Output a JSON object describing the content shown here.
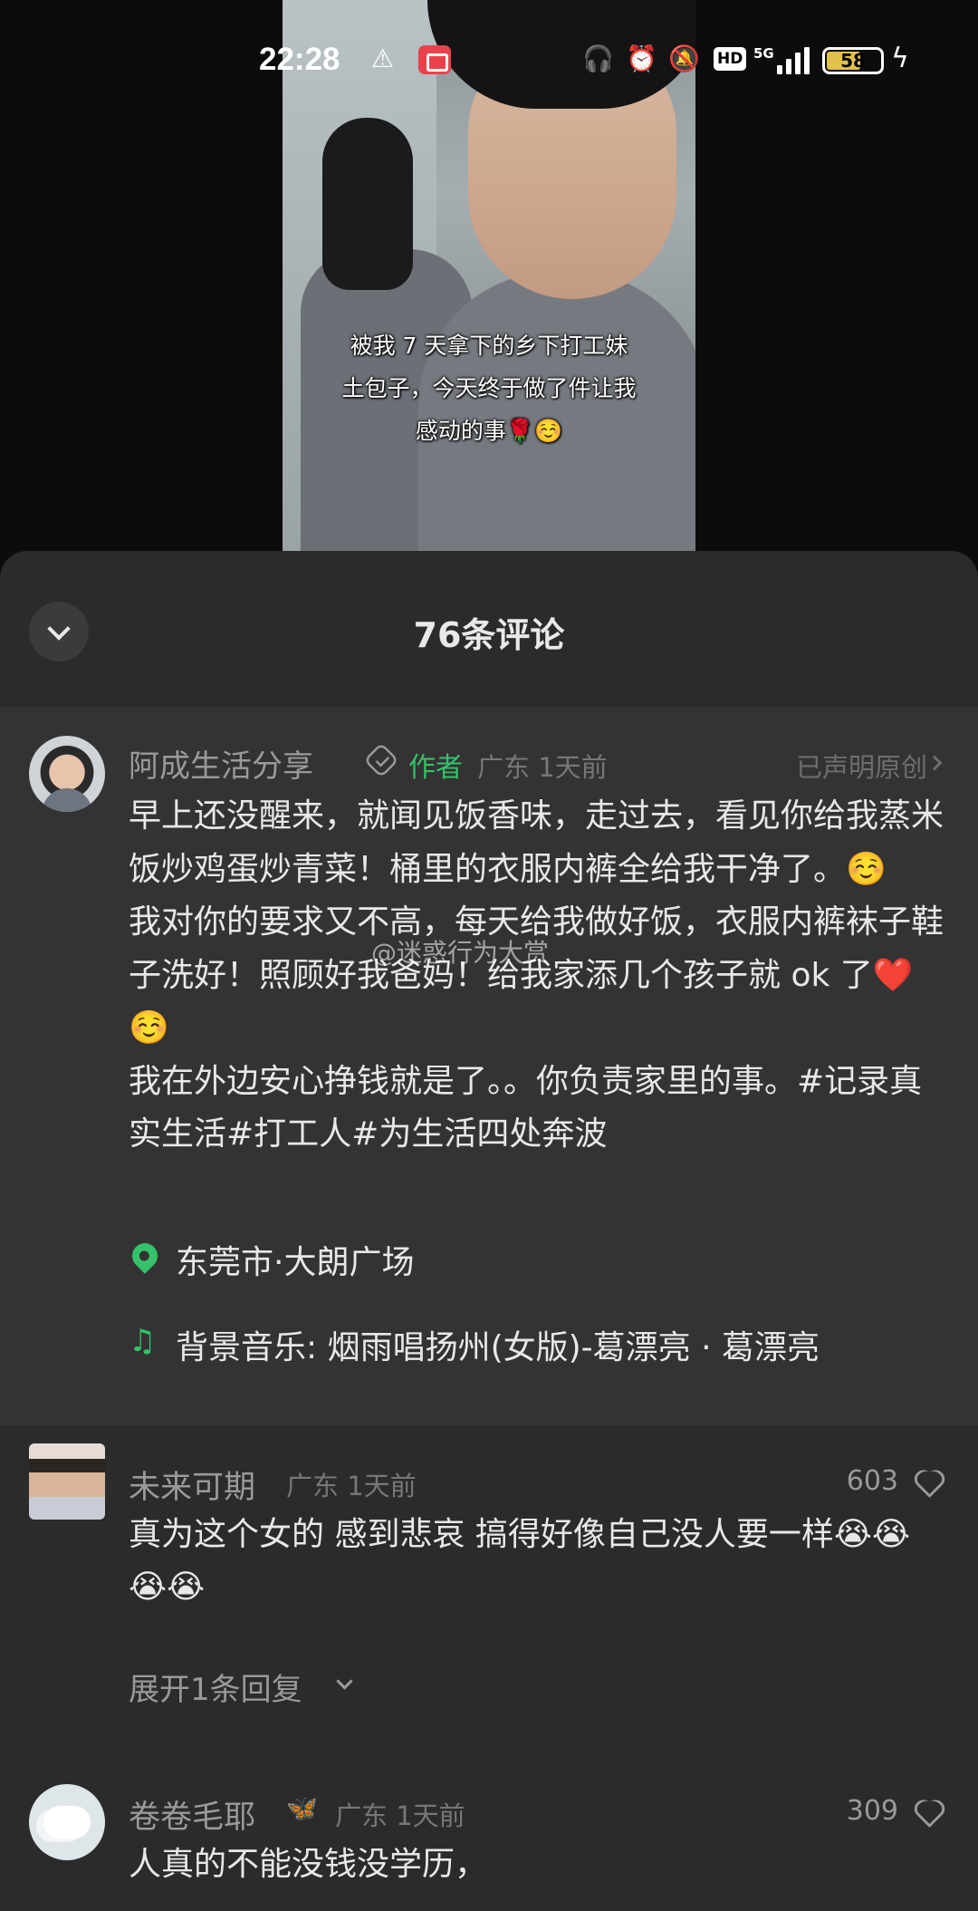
{
  "status_bar": {
    "time": "22:28",
    "network": "5G",
    "hd_label": "HD",
    "battery_level": "58",
    "icons": [
      "warning-icon",
      "screen-record-icon",
      "headphones-icon",
      "alarm-icon",
      "mute-icon",
      "hd-icon",
      "signal-icon",
      "battery-icon",
      "charging-icon"
    ]
  },
  "video": {
    "caption_line1": "被我 7 天拿下的乡下打工妹",
    "caption_line2": "土包子，今天终于做了件让我",
    "caption_line3": "感动的事🌹☺️"
  },
  "sheet": {
    "title": "76条评论"
  },
  "author_post": {
    "name": "阿成生活分享",
    "tag": "作者",
    "meta": "广东 1天前",
    "original_label": "已声明原创",
    "text": "早上还没醒来，就闻见饭香味，走过去，看见你给我蒸米饭炒鸡蛋炒青菜！桶里的衣服内裤全给我干净了。☺️\n我对你的要求又不高，每天给我做好饭，衣服内裤袜子鞋子洗好！照顾好我爸妈！给我家添几个孩子就 ok 了❤️☺️\n我在外边安心挣钱就是了。。你负责家里的事。#记录真实生活#打工人#为生活四处奔波",
    "location": "东莞市·大朗广场",
    "music": "背景音乐: 烟雨唱扬州(女版)-葛漂亮 · 葛漂亮"
  },
  "watermark": "@迷惑行为大赏",
  "comments": [
    {
      "name": "未来可期",
      "meta": "广东 1天前",
      "likes": "603",
      "text": "真为这个女的 感到悲哀 搞得好像自己没人要一样😭😭😭😭",
      "expand": "展开1条回复"
    },
    {
      "name": "卷卷毛耶",
      "badge": "🦋",
      "meta": "广东 1天前",
      "likes": "309",
      "text": "人真的不能没钱没学历，"
    }
  ],
  "colors": {
    "accent_green": "#35c26a",
    "sheet_bg": "#2b2b2b",
    "post_bg": "#333333"
  }
}
